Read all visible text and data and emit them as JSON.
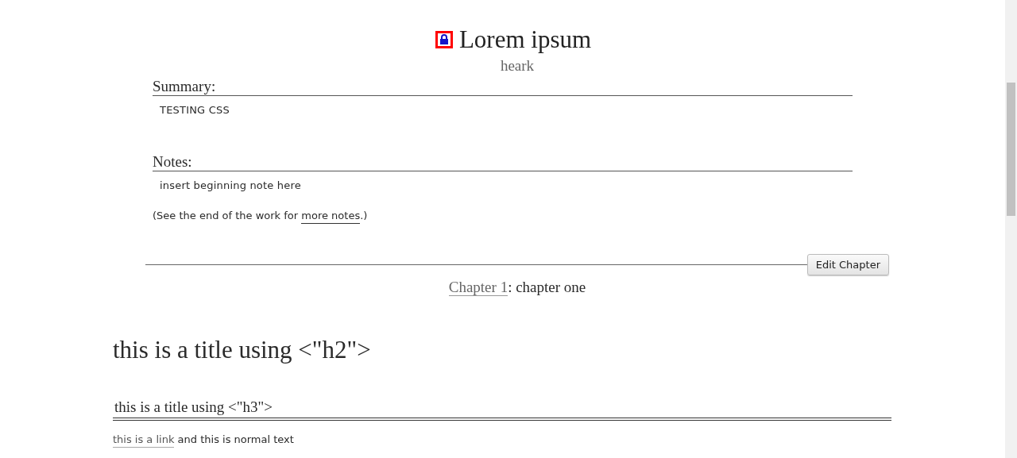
{
  "work": {
    "title": "Lorem ipsum",
    "locked": true,
    "author": "heark"
  },
  "summary": {
    "heading": "Summary:",
    "text": "TESTING CSS"
  },
  "notes": {
    "heading": "Notes:",
    "text": "insert beginning note here",
    "end_note_before": "(See the end of the work for ",
    "end_note_link": "more notes",
    "end_note_after": ".)"
  },
  "edit_button": "Edit Chapter",
  "chapter": {
    "link": "Chapter 1",
    "title": ": chapter one"
  },
  "content": [
    {
      "kind": "h2",
      "text": "this is a title using <\"h2\">"
    },
    {
      "kind": "h3",
      "text": "this is a title using <\"h3\">"
    },
    {
      "kind": "para",
      "link": "this is a link",
      "text": " and this is normal text"
    }
  ]
}
